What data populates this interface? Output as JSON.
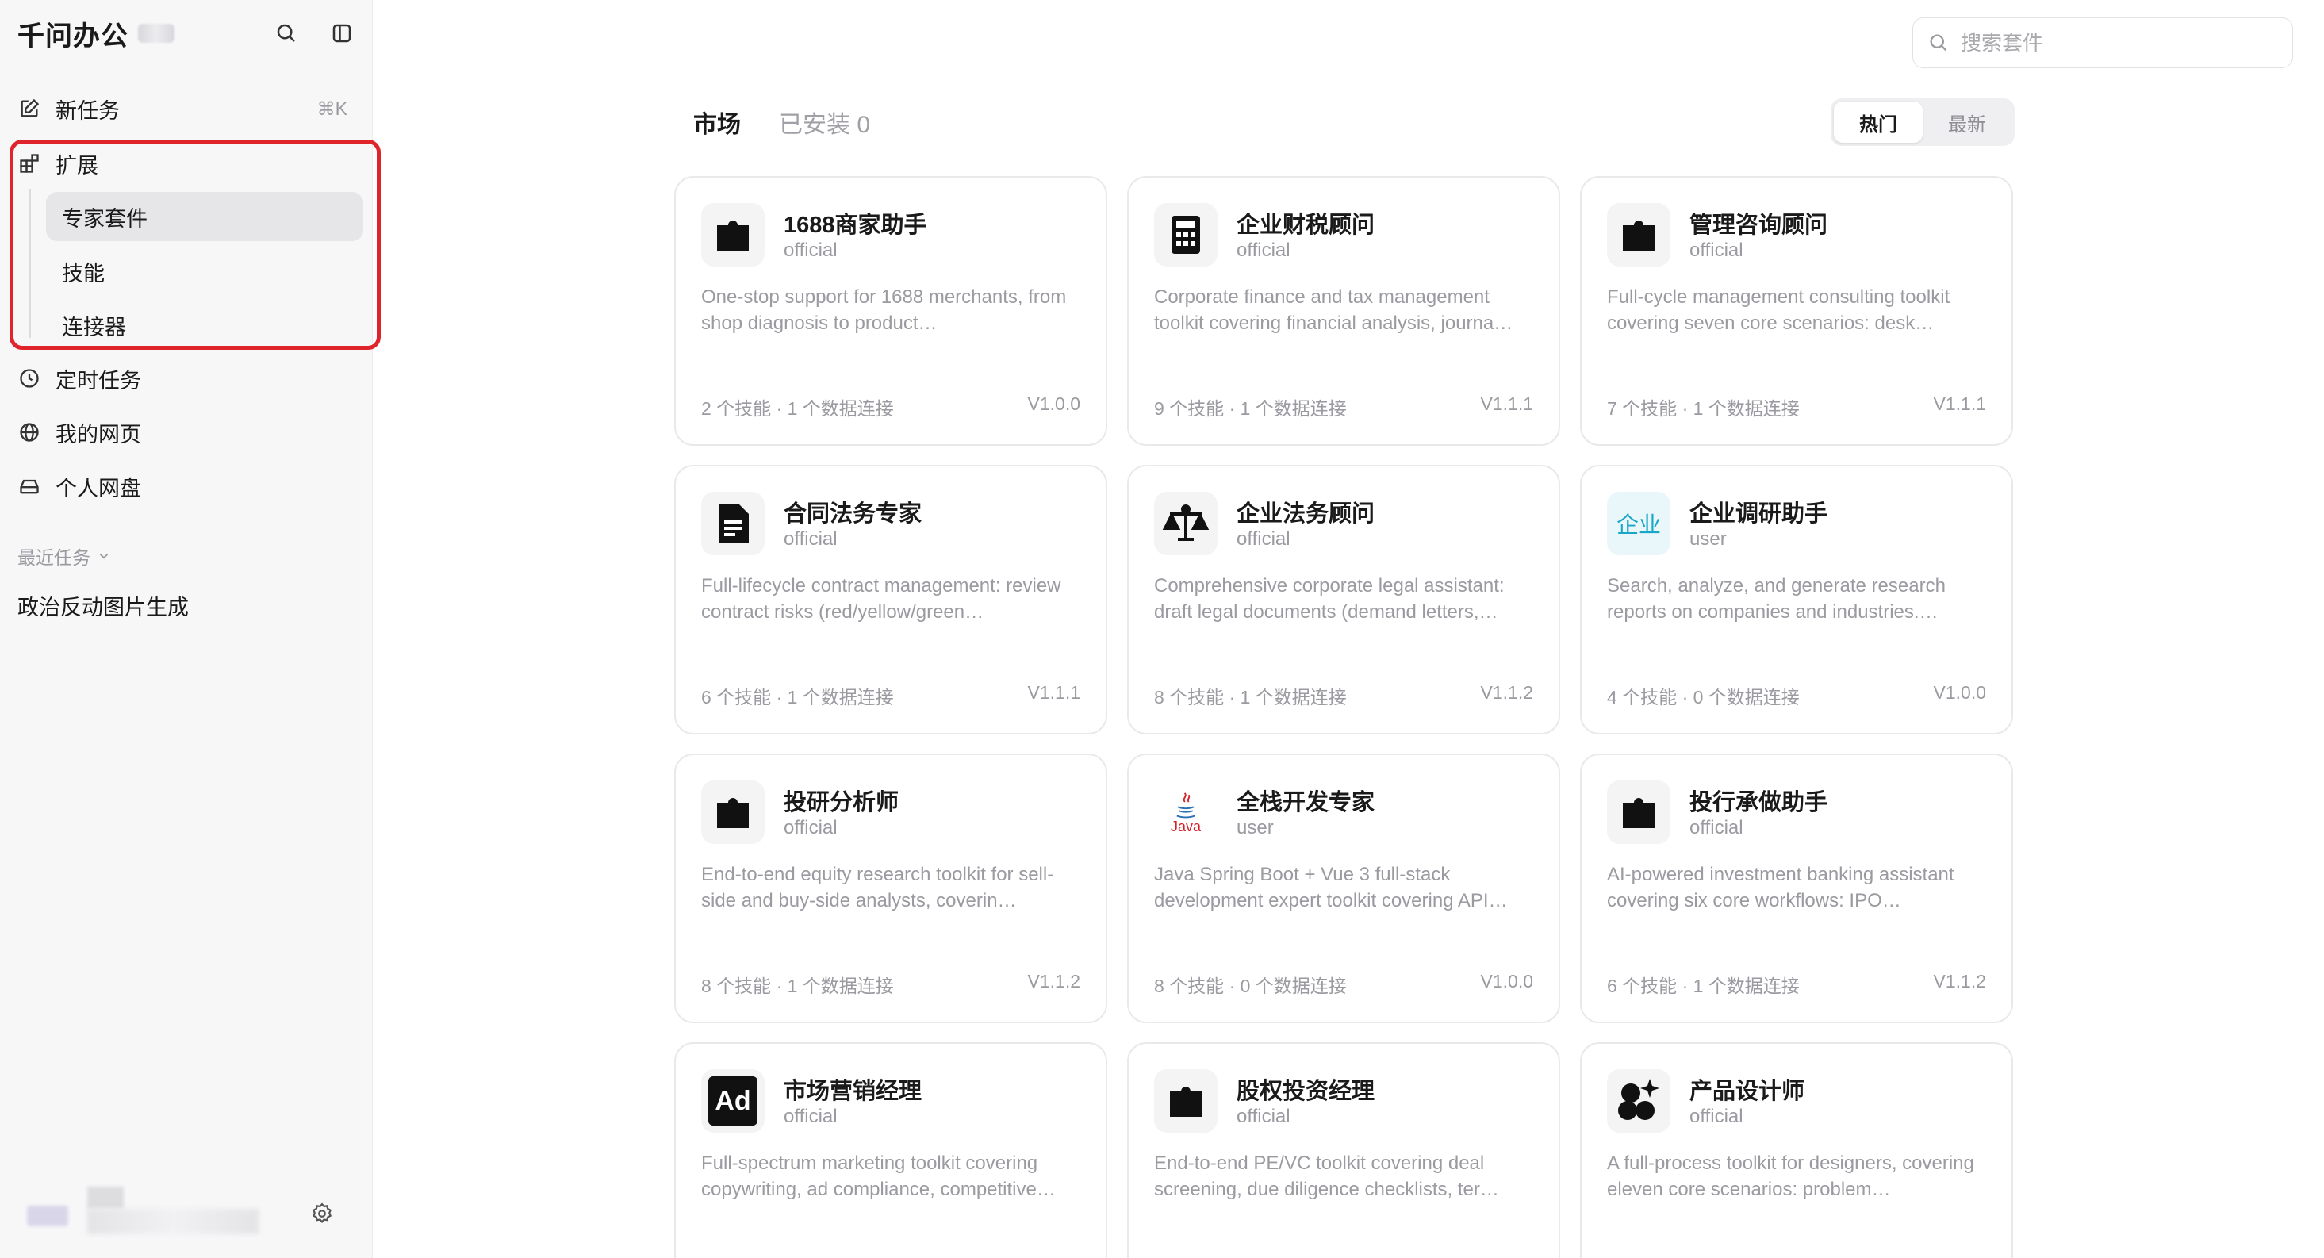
{
  "sidebar": {
    "brand": "千问办公",
    "nav": {
      "new_task": "新任务",
      "new_task_shortcut": "⌘K",
      "extensions": "扩展",
      "sub": [
        "专家套件",
        "技能",
        "连接器"
      ],
      "scheduled": "定时任务",
      "webpages": "我的网页",
      "drive": "个人网盘"
    },
    "recent_label": "最近任务",
    "recent_items": [
      "政治反动图片生成"
    ]
  },
  "main": {
    "search_placeholder": "搜索套件",
    "tabs": [
      "市场",
      "已安装 0"
    ],
    "sort": [
      "热门",
      "最新"
    ]
  },
  "cards": [
    {
      "icon": "puzzle-icon",
      "title": "1688商家助手",
      "badge": "official",
      "desc": "One-stop support for 1688 merchants, from shop diagnosis to product…",
      "meta": "2 个技能 · 1 个数据连接",
      "version": "V1.0.0"
    },
    {
      "icon": "calculator-icon",
      "title": "企业财税顾问",
      "badge": "official",
      "desc": "Corporate finance and tax management toolkit covering financial analysis, journa…",
      "meta": "9 个技能 · 1 个数据连接",
      "version": "V1.1.1"
    },
    {
      "icon": "puzzle-icon",
      "title": "管理咨询顾问",
      "badge": "official",
      "desc": "Full-cycle management consulting toolkit covering seven core scenarios: desk…",
      "meta": "7 个技能 · 1 个数据连接",
      "version": "V1.1.1"
    },
    {
      "icon": "document-icon",
      "title": "合同法务专家",
      "badge": "official",
      "desc": "Full-lifecycle contract management: review contract risks (red/yellow/green…",
      "meta": "6 个技能 · 1 个数据连接",
      "version": "V1.1.1"
    },
    {
      "icon": "scales-icon",
      "title": "企业法务顾问",
      "badge": "official",
      "desc": "Comprehensive corporate legal assistant: draft legal documents (demand letters,…",
      "meta": "8 个技能 · 1 个数据连接",
      "version": "V1.1.2"
    },
    {
      "icon": "enterprise-text-icon",
      "icon_text": "企业",
      "title": "企业调研助手",
      "badge": "user",
      "desc": "Search, analyze, and generate research reports on companies and industries.…",
      "meta": "4 个技能 · 0 个数据连接",
      "version": "V1.0.0"
    },
    {
      "icon": "puzzle-icon",
      "title": "投研分析师",
      "badge": "official",
      "desc": "End-to-end equity research toolkit for sell-side and buy-side analysts, coverin…",
      "meta": "8 个技能 · 1 个数据连接",
      "version": "V1.1.2"
    },
    {
      "icon": "java-icon",
      "icon_text": "Java",
      "title": "全栈开发专家",
      "badge": "user",
      "desc": "Java Spring Boot + Vue 3 full-stack development expert toolkit covering API…",
      "meta": "8 个技能 · 0 个数据连接",
      "version": "V1.0.0"
    },
    {
      "icon": "puzzle-icon",
      "title": "投行承做助手",
      "badge": "official",
      "desc": "AI-powered investment banking assistant covering six core workflows: IPO…",
      "meta": "6 个技能 · 1 个数据连接",
      "version": "V1.1.2"
    },
    {
      "icon": "ad-icon",
      "icon_text": "Ad",
      "title": "市场营销经理",
      "badge": "official",
      "desc": "Full-spectrum marketing toolkit covering copywriting, ad compliance, competitive…",
      "meta": "",
      "version": ""
    },
    {
      "icon": "puzzle-icon",
      "title": "股权投资经理",
      "badge": "official",
      "desc": "End-to-end PE/VC toolkit covering deal screening, due diligence checklists, ter…",
      "meta": "",
      "version": ""
    },
    {
      "icon": "design-shapes-icon",
      "title": "产品设计师",
      "badge": "official",
      "desc": "A full-process toolkit for designers, covering eleven core scenarios: problem…",
      "meta": "",
      "version": ""
    }
  ],
  "colors": {
    "highlight_border": "#e0242b",
    "enterprise_icon": "#19a7c7",
    "java_red": "#d2232a",
    "java_blue": "#2c6fb5"
  }
}
